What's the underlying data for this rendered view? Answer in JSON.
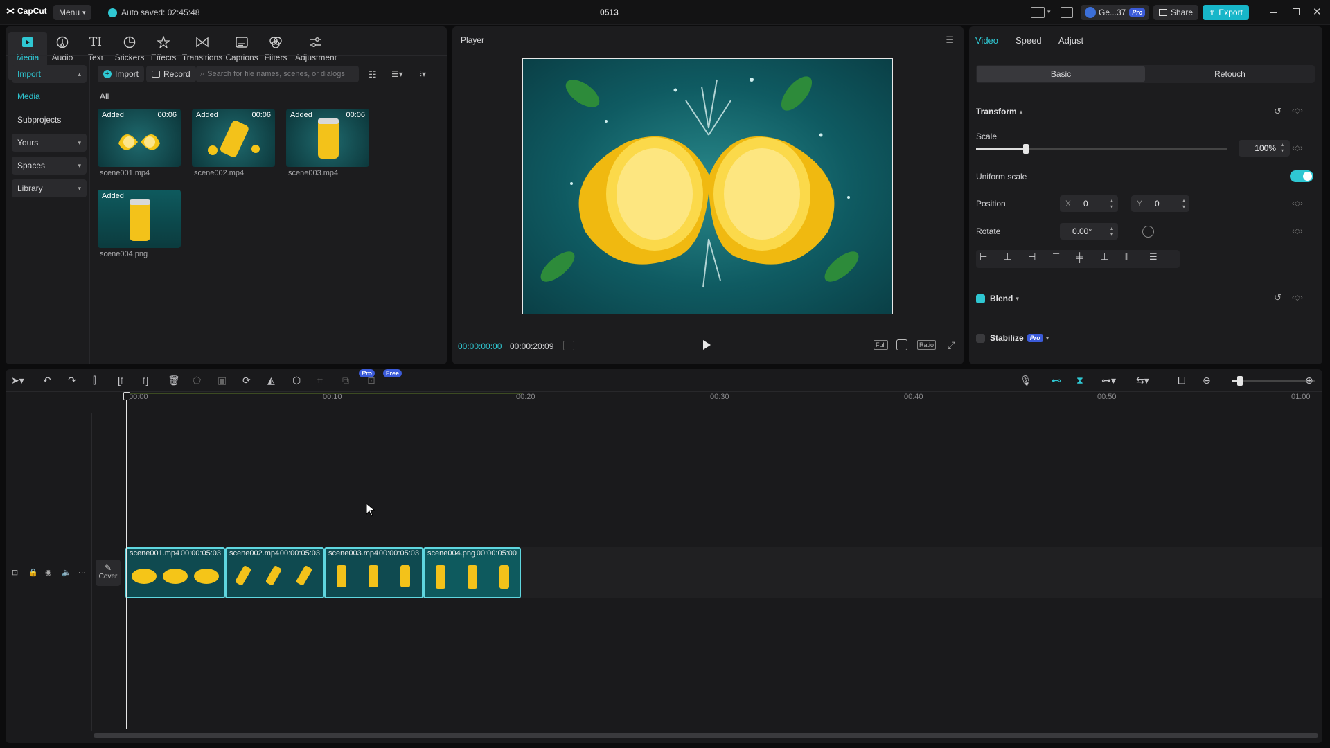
{
  "titlebar": {
    "logo": "CapCut",
    "menu": "Menu",
    "autosave": "Auto saved: 02:45:48",
    "project": "0513",
    "account": "Ge...37",
    "pro_badge": "Pro",
    "share": "Share",
    "export": "Export"
  },
  "toolbar": [
    {
      "label": "Media",
      "icon": "media-icon"
    },
    {
      "label": "Audio",
      "icon": "audio-icon"
    },
    {
      "label": "Text",
      "icon": "text-icon"
    },
    {
      "label": "Stickers",
      "icon": "sticker-icon"
    },
    {
      "label": "Effects",
      "icon": "effects-icon"
    },
    {
      "label": "Transitions",
      "icon": "transitions-icon"
    },
    {
      "label": "Captions",
      "icon": "captions-icon"
    },
    {
      "label": "Filters",
      "icon": "filters-icon"
    },
    {
      "label": "Adjustment",
      "icon": "adjustment-icon"
    }
  ],
  "sidebar": {
    "import": "Import",
    "media": "Media",
    "subprojects": "Subprojects",
    "yours": "Yours",
    "spaces": "Spaces",
    "library": "Library"
  },
  "media": {
    "import_btn": "Import",
    "record_btn": "Record",
    "search_placeholder": "Search for file names, scenes, or dialogs",
    "filter_all": "All",
    "items": [
      {
        "tag": "Added",
        "duration": "00:06",
        "name": "scene001.mp4"
      },
      {
        "tag": "Added",
        "duration": "00:06",
        "name": "scene002.mp4"
      },
      {
        "tag": "Added",
        "duration": "00:06",
        "name": "scene003.mp4"
      },
      {
        "tag": "Added",
        "duration": "",
        "name": "scene004.png"
      }
    ]
  },
  "player": {
    "title": "Player",
    "current_time": "00:00:00:00",
    "total_time": "00:00:20:09",
    "btn_full": "Full",
    "btn_ratio": "Ratio"
  },
  "inspector": {
    "tabs": [
      "Video",
      "Speed",
      "Adjust"
    ],
    "subtabs": [
      "Basic",
      "Retouch"
    ],
    "transform": "Transform",
    "scale_label": "Scale",
    "scale_value": "100%",
    "scale_fraction": 0.2,
    "uniform_scale": "Uniform scale",
    "position": "Position",
    "pos_x_label": "X",
    "pos_x": "0",
    "pos_y_label": "Y",
    "pos_y": "0",
    "rotate": "Rotate",
    "rotate_value": "0.00°",
    "blend": "Blend",
    "stabilize": "Stabilize",
    "pro": "Pro"
  },
  "timeline": {
    "badge_pro": "Pro",
    "badge_free": "Free",
    "ticks": [
      "00:00",
      "00:10",
      "00:20",
      "00:30",
      "00:40",
      "00:50",
      "01:00"
    ],
    "cover": "Cover",
    "clips": [
      {
        "name": "scene001.mp4",
        "duration": "00:00:05:03"
      },
      {
        "name": "scene002.mp4",
        "duration": "00:00:05:03"
      },
      {
        "name": "scene003.mp4",
        "duration": "00:00:05:03"
      },
      {
        "name": "scene004.png",
        "duration": "00:00:05:00"
      }
    ]
  },
  "colors": {
    "accent": "#2fc7d2",
    "export": "#17b6c9",
    "teal_bg": "#0f4b52",
    "lemon": "#f5c518"
  }
}
